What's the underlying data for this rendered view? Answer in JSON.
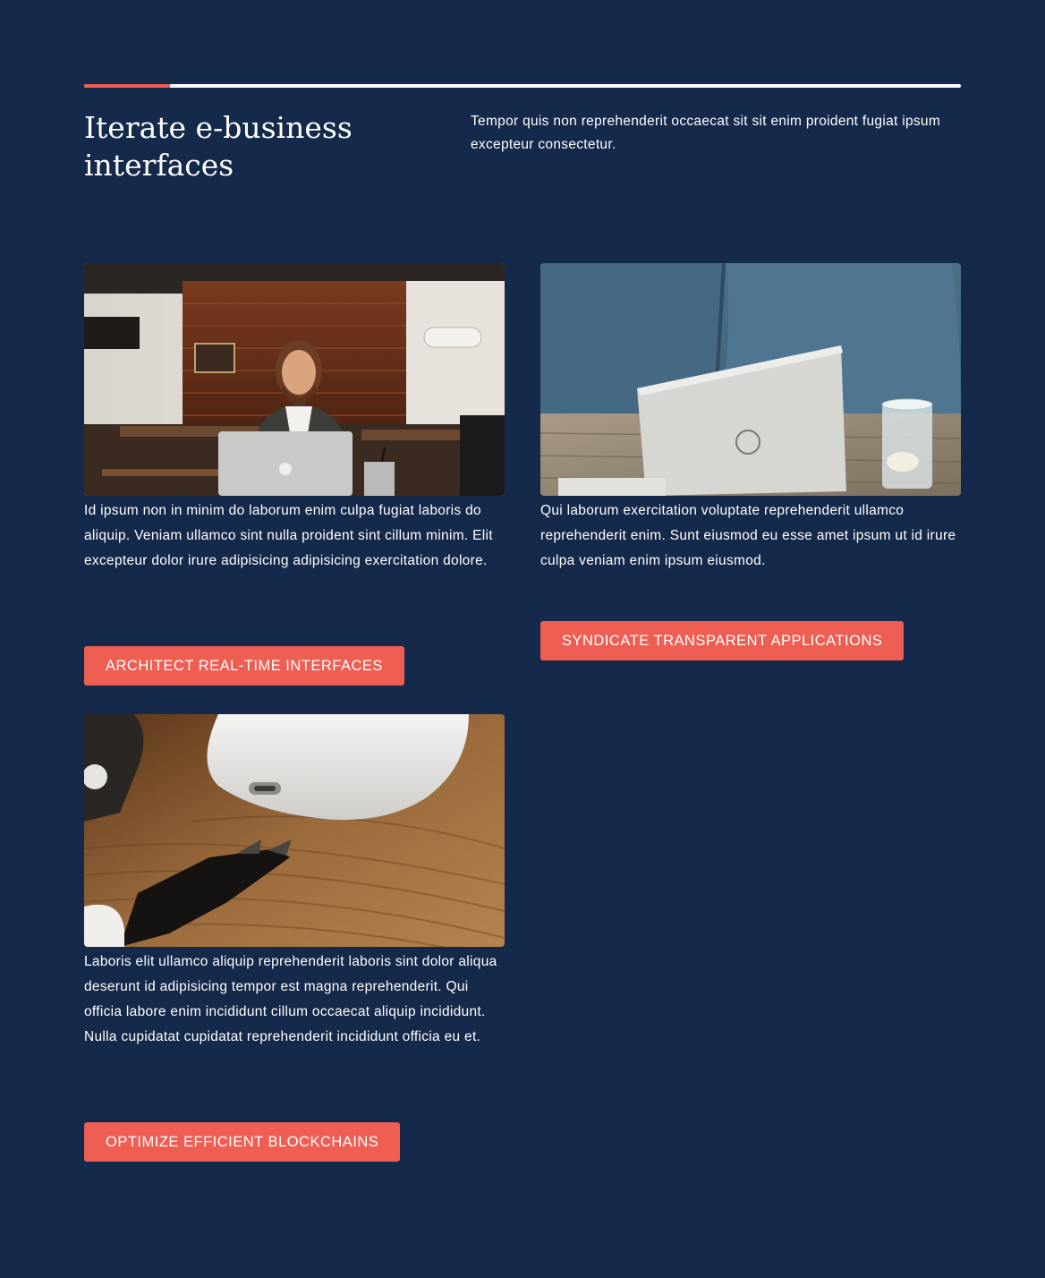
{
  "section": {
    "heading": "Iterate e-business interfaces",
    "intro": "Tempor quis non reprehenderit occaecat sit sit enim proident fugiat ipsum excepteur consectetur."
  },
  "colors": {
    "background": "#15294a",
    "accent": "#ee5e53",
    "text": "#ffffff"
  },
  "cards": [
    {
      "image": "man-smiling-with-laptop-in-cafe-photo",
      "text": "Id ipsum non in minim do laborum enim culpa fugiat laboris do aliquip. Veniam ullamco sint nulla proident sint cillum minim. Elit excepteur dolor irure adipisicing adipisicing exercitation dolore.",
      "button": "ARCHITECT REAL-TIME INTERFACES"
    },
    {
      "image": "laptop-on-table-with-glass-photo",
      "text": "Qui laborum exercitation voluptate reprehenderit ullamco reprehenderit enim. Sunt eiusmod eu esse amet ipsum ut id irure culpa veniam enim ipsum eiusmod.",
      "button": "SYNDICATE TRANSPARENT APPLICATIONS"
    },
    {
      "image": "earbuds-case-on-wooden-desk-photo",
      "text": "Laboris elit ullamco aliquip reprehenderit laboris sint dolor aliqua deserunt id adipisicing tempor est magna reprehenderit. Qui officia labore enim incididunt cillum occaecat aliquip incididunt. Nulla cupidatat cupidatat reprehenderit incididunt officia eu et.",
      "button": "OPTIMIZE EFFICIENT BLOCKCHAINS"
    }
  ]
}
